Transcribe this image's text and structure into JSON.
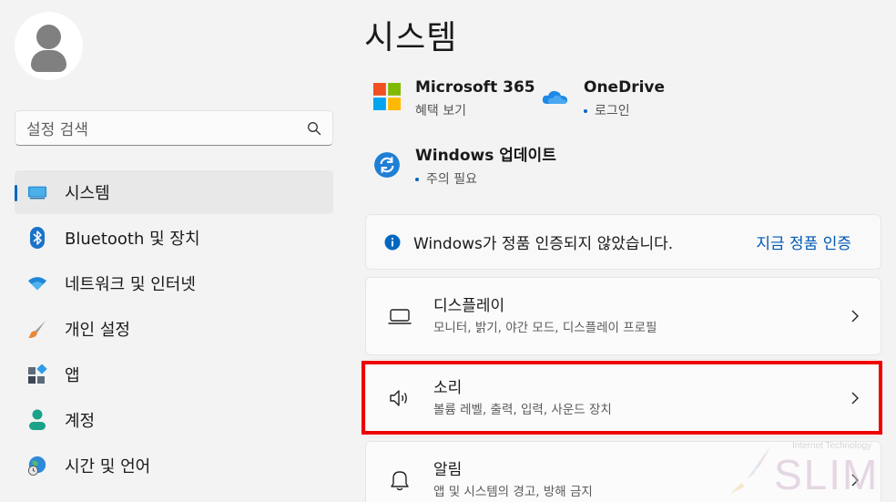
{
  "sidebar": {
    "search": {
      "placeholder": "설정 검색"
    },
    "items": [
      {
        "label": "시스템",
        "icon": "monitor-icon",
        "active": true
      },
      {
        "label": "Bluetooth 및 장치",
        "icon": "bluetooth-icon"
      },
      {
        "label": "네트워크 및 인터넷",
        "icon": "wifi-icon"
      },
      {
        "label": "개인 설정",
        "icon": "paintbrush-icon"
      },
      {
        "label": "앱",
        "icon": "apps-icon"
      },
      {
        "label": "계정",
        "icon": "person-icon"
      },
      {
        "label": "시간 및 언어",
        "icon": "globe-clock-icon"
      }
    ]
  },
  "main": {
    "title": "시스템",
    "quick_links": [
      {
        "title": "Microsoft 365",
        "subtitle": "혜택 보기",
        "icon": "microsoft-logo-icon"
      },
      {
        "title": "OneDrive",
        "subtitle": "로그인",
        "icon": "onedrive-cloud-icon"
      },
      {
        "title": "Windows 업데이트",
        "subtitle": "주의 필요",
        "icon": "windows-update-icon"
      }
    ],
    "notice": {
      "text": "Windows가 정품 인증되지 않았습니다.",
      "link": "지금 정품 인증"
    },
    "cards": [
      {
        "title": "디스플레이",
        "subtitle": "모니터, 밝기, 야간 모드, 디스플레이 프로필",
        "icon": "display-icon"
      },
      {
        "title": "소리",
        "subtitle": "볼륨 레벨, 출력, 입력, 사운드 장치",
        "icon": "speaker-icon"
      },
      {
        "title": "알림",
        "subtitle": "앱 및 시스템의 경고, 방해 금지",
        "icon": "bell-icon"
      }
    ]
  },
  "watermark": {
    "top": "Internet Technology",
    "brand": "SLIM"
  },
  "colors": {
    "accent": "#0067c0",
    "highlight": "#ee0000",
    "link": "#0059b5"
  }
}
